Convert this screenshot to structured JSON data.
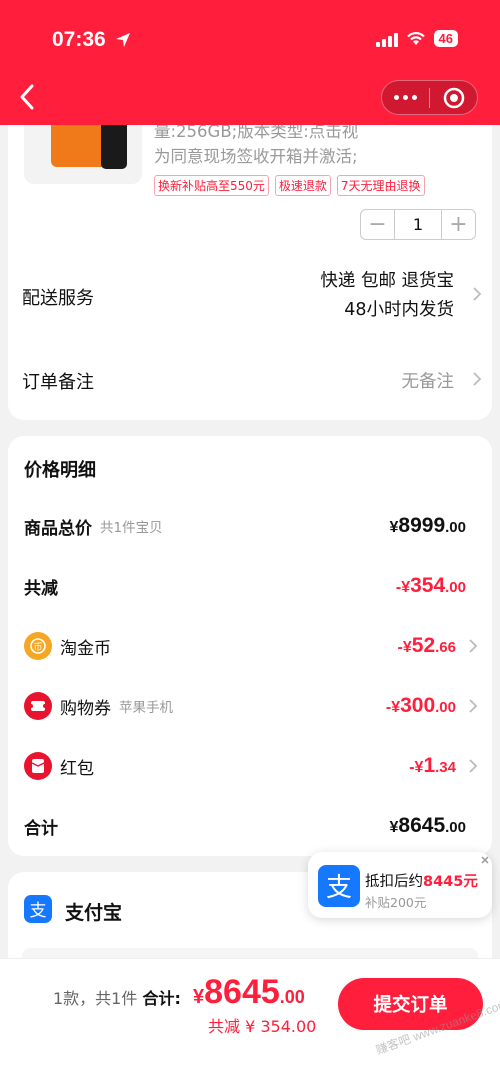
{
  "status": {
    "time": "07:36",
    "battery": "46"
  },
  "product": {
    "desc_line1": "量:256GB;版本类型:点击视",
    "desc_line2": "为同意现场签收开箱并激活;",
    "tags": [
      "换新补贴高至550元",
      "极速退款",
      "7天无理由退换"
    ],
    "quantity": "1"
  },
  "delivery": {
    "label": "配送服务",
    "line1": "快递 包邮 退货宝",
    "line2": "48小时内发货"
  },
  "remark": {
    "label": "订单备注",
    "value": "无备注"
  },
  "price": {
    "title": "价格明细",
    "goods_total": {
      "label": "商品总价",
      "sub": "共1件宝贝",
      "cur": "¥",
      "int": "8999",
      "dec": ".00"
    },
    "total_reduce": {
      "label": "共减",
      "cur": "-¥",
      "int": "354",
      "dec": ".00"
    },
    "taojinbi": {
      "label": "淘金币",
      "cur": "-¥",
      "int": "52",
      "dec": ".66"
    },
    "coupon": {
      "label": "购物券",
      "sub": "苹果手机",
      "cur": "-¥",
      "int": "300",
      "dec": ".00"
    },
    "redpack": {
      "label": "红包",
      "cur": "-¥",
      "int": "1",
      "dec": ".34"
    },
    "sum": {
      "label": "合计",
      "cur": "¥",
      "int": "8645",
      "dec": ".00"
    }
  },
  "payment": {
    "name": "支付宝"
  },
  "popup": {
    "prefix": "抵扣后约",
    "amount": "8445元",
    "sub": "补贴200元"
  },
  "bottom": {
    "count": "1款，共1件",
    "total_label": "合计:",
    "cur": "¥",
    "int": "8645",
    "dec": ".00",
    "discount": "共减 ¥ 354.00",
    "submit": "提交订单"
  },
  "watermark": "赚客吧 www.zuanke8.com",
  "colors": {
    "brand_red": "#ff1e3c",
    "alipay_blue": "#1677ff",
    "coin_gold": "#f5a623"
  }
}
